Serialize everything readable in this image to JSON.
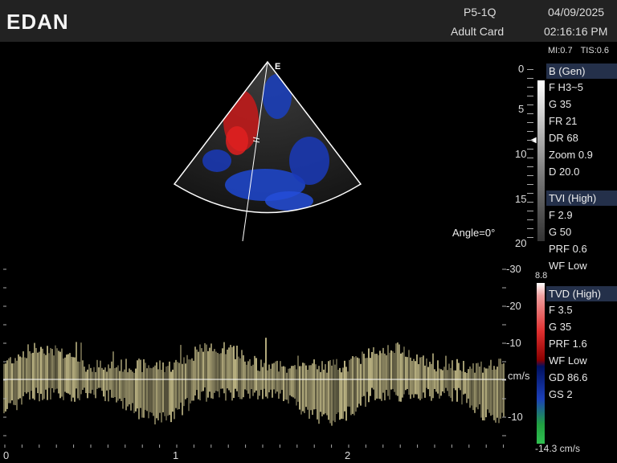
{
  "header": {
    "logo": "EDAN",
    "probe": "P5-1Q",
    "preset": "Adult Card",
    "date": "04/09/2025",
    "time": "02:16:16 PM"
  },
  "indices": {
    "mi": "MI:0.7",
    "tis": "TIS:0.6"
  },
  "sector_marker": "E",
  "b_mode": {
    "title": "B (Gen)",
    "params": [
      "F H3~5",
      "G 35",
      "FR 21",
      "DR 68",
      "Zoom 0.9",
      "D 20.0"
    ]
  },
  "tvi": {
    "title": "TVI (High)",
    "params": [
      "F 2.9",
      "G 50",
      "PRF 0.6",
      "WF Low"
    ]
  },
  "tvd": {
    "title": "TVD (High)",
    "params": [
      "F 3.5",
      "G 35",
      "PRF 1.6",
      "WF Low",
      "GD 86.6",
      "GS 2"
    ]
  },
  "depth_scale": [
    "0",
    "5",
    "10",
    "15",
    "20"
  ],
  "color_scale": {
    "top": "8.8",
    "bottom": "-14.3 cm/s"
  },
  "angle": "Angle=0°",
  "doppler_scale": {
    "labels": [
      "-30",
      "-20",
      "-10",
      "cm/s",
      "-10"
    ]
  },
  "time_axis": [
    "0",
    "1",
    "2"
  ],
  "colors": {
    "header_bg": "#222222",
    "section_bg": "#24304a",
    "spectrum": "#e6dca0"
  }
}
